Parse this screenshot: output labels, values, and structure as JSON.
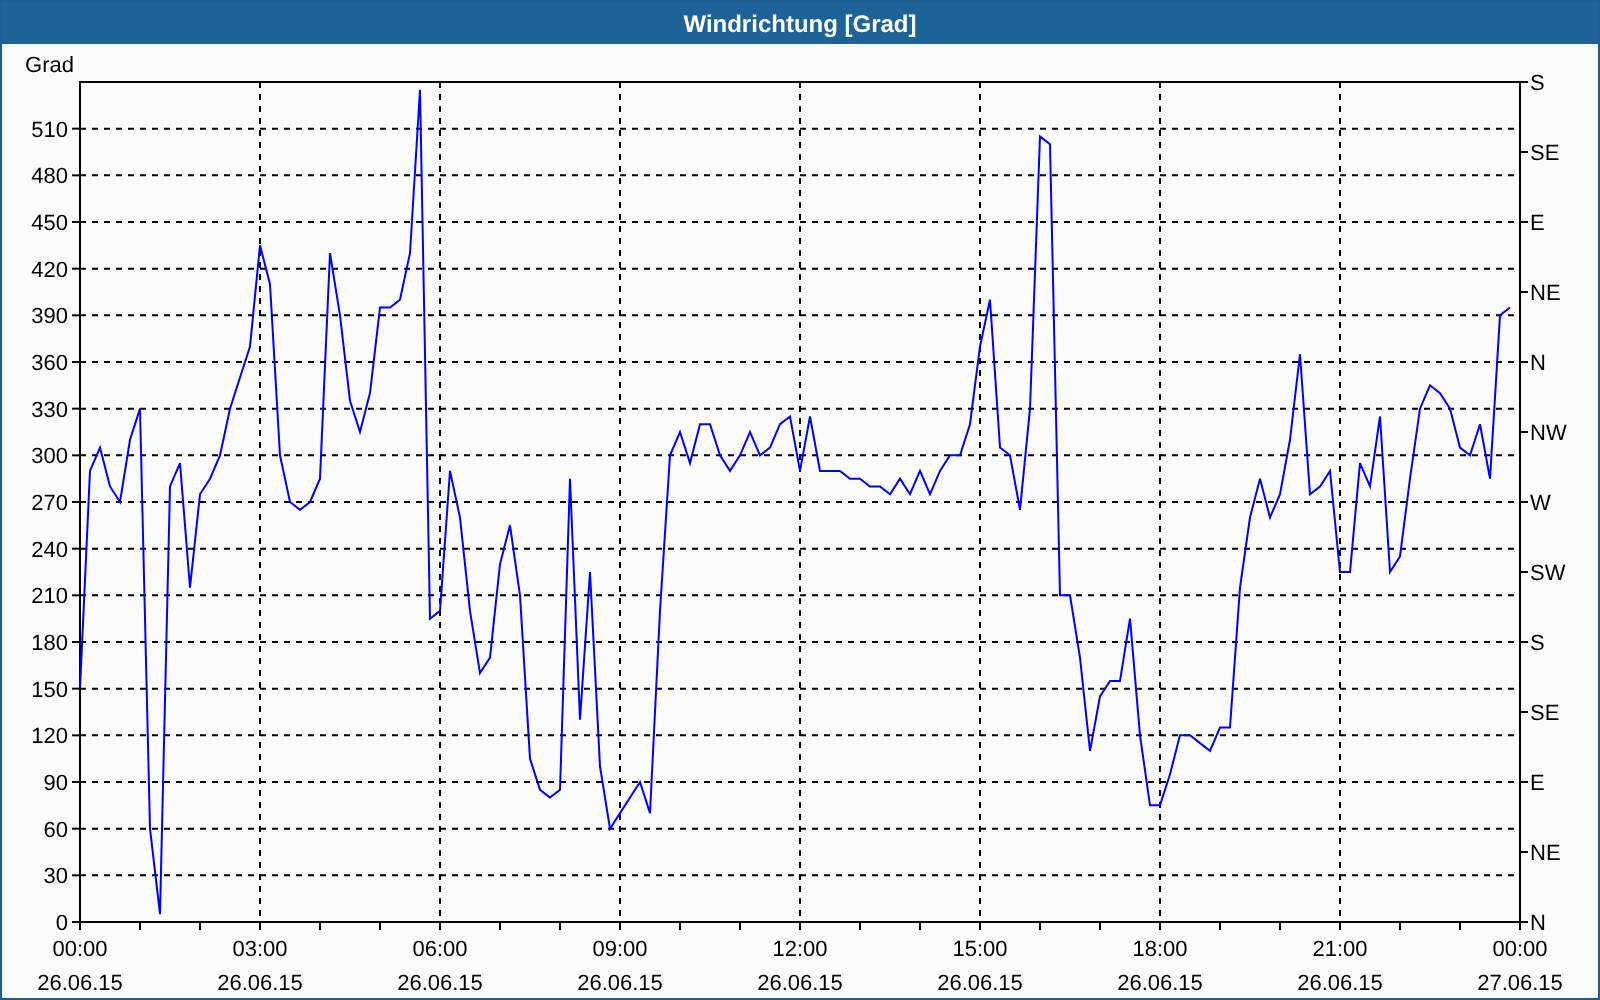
{
  "window": {
    "title": "Windrichtung [Grad]"
  },
  "chart_data": {
    "type": "line",
    "ylabel": "Grad",
    "ylim": [
      0,
      540
    ],
    "grid": true,
    "categories": [
      "00:00\n26.06.15",
      null,
      null,
      null,
      null,
      null,
      null,
      null,
      null,
      null,
      null,
      null,
      null,
      null,
      null,
      null,
      null,
      null,
      "03:00\n26.06.15",
      null,
      null,
      null,
      null,
      null,
      null,
      null,
      null,
      null,
      null,
      null,
      null,
      null,
      null,
      null,
      null,
      null,
      "06:00\n26.06.15",
      null,
      null,
      null,
      null,
      null,
      null,
      null,
      null,
      null,
      null,
      null,
      null,
      null,
      null,
      null,
      null,
      null,
      "09:00\n26.06.15",
      null,
      null,
      null,
      null,
      null,
      null,
      null,
      null,
      null,
      null,
      null,
      null,
      null,
      null,
      null,
      null,
      null,
      "12:00\n26.06.15",
      null,
      null,
      null,
      null,
      null,
      null,
      null,
      null,
      null,
      null,
      null,
      null,
      null,
      null,
      null,
      null,
      null,
      "15:00\n26.06.15",
      null,
      null,
      null,
      null,
      null,
      null,
      null,
      null,
      null,
      null,
      null,
      null,
      null,
      null,
      null,
      null,
      null,
      "18:00\n26.06.15",
      null,
      null,
      null,
      null,
      null,
      null,
      null,
      null,
      null,
      null,
      null,
      null,
      null,
      null,
      null,
      null,
      null,
      "21:00\n26.06.15",
      null,
      null,
      null,
      null,
      null,
      null,
      null,
      null,
      null,
      null,
      null,
      null,
      null,
      null,
      null,
      null,
      null,
      "00:00\n27.06.15"
    ],
    "series": [
      {
        "color": "#0000ff",
        "values": [
          150,
          290,
          305,
          280,
          270,
          310,
          330,
          60,
          5,
          280,
          295,
          215,
          275,
          285,
          300,
          330,
          350,
          370,
          435,
          410,
          300,
          270,
          265,
          270,
          285,
          430,
          390,
          335,
          315,
          340,
          395,
          395,
          400,
          430,
          535,
          195,
          200,
          290,
          260,
          200,
          160,
          170,
          230,
          255,
          210,
          105,
          85,
          80,
          85,
          285,
          130,
          225,
          100,
          60,
          70,
          80,
          90,
          70,
          200,
          300,
          315,
          295,
          320,
          320,
          300,
          290,
          300,
          315,
          300,
          305,
          320,
          325,
          290,
          325,
          290,
          290,
          290,
          285,
          285,
          280,
          280,
          275,
          285,
          275,
          290,
          275,
          290,
          300,
          300,
          320,
          370,
          400,
          305,
          300,
          265,
          330,
          505,
          500,
          210,
          210,
          170,
          110,
          145,
          155,
          155,
          195,
          120,
          75,
          75,
          95,
          120,
          120,
          115,
          110,
          125,
          125,
          215,
          260,
          285,
          260,
          275,
          310,
          365,
          275,
          280,
          290,
          225,
          225,
          295,
          280,
          325,
          225,
          235,
          285,
          330,
          345,
          340,
          330,
          305,
          300,
          320,
          285,
          390,
          395,
          null
        ]
      }
    ],
    "yticks": [
      0,
      30,
      60,
      90,
      120,
      150,
      180,
      210,
      240,
      270,
      300,
      330,
      360,
      390,
      420,
      450,
      480,
      510
    ]
  },
  "compass_axis": {
    "labels": [
      "S",
      "SE",
      "E",
      "NE",
      "N",
      "NW",
      "W",
      "SW",
      "S",
      "SE",
      "E",
      "NE",
      "N"
    ]
  }
}
